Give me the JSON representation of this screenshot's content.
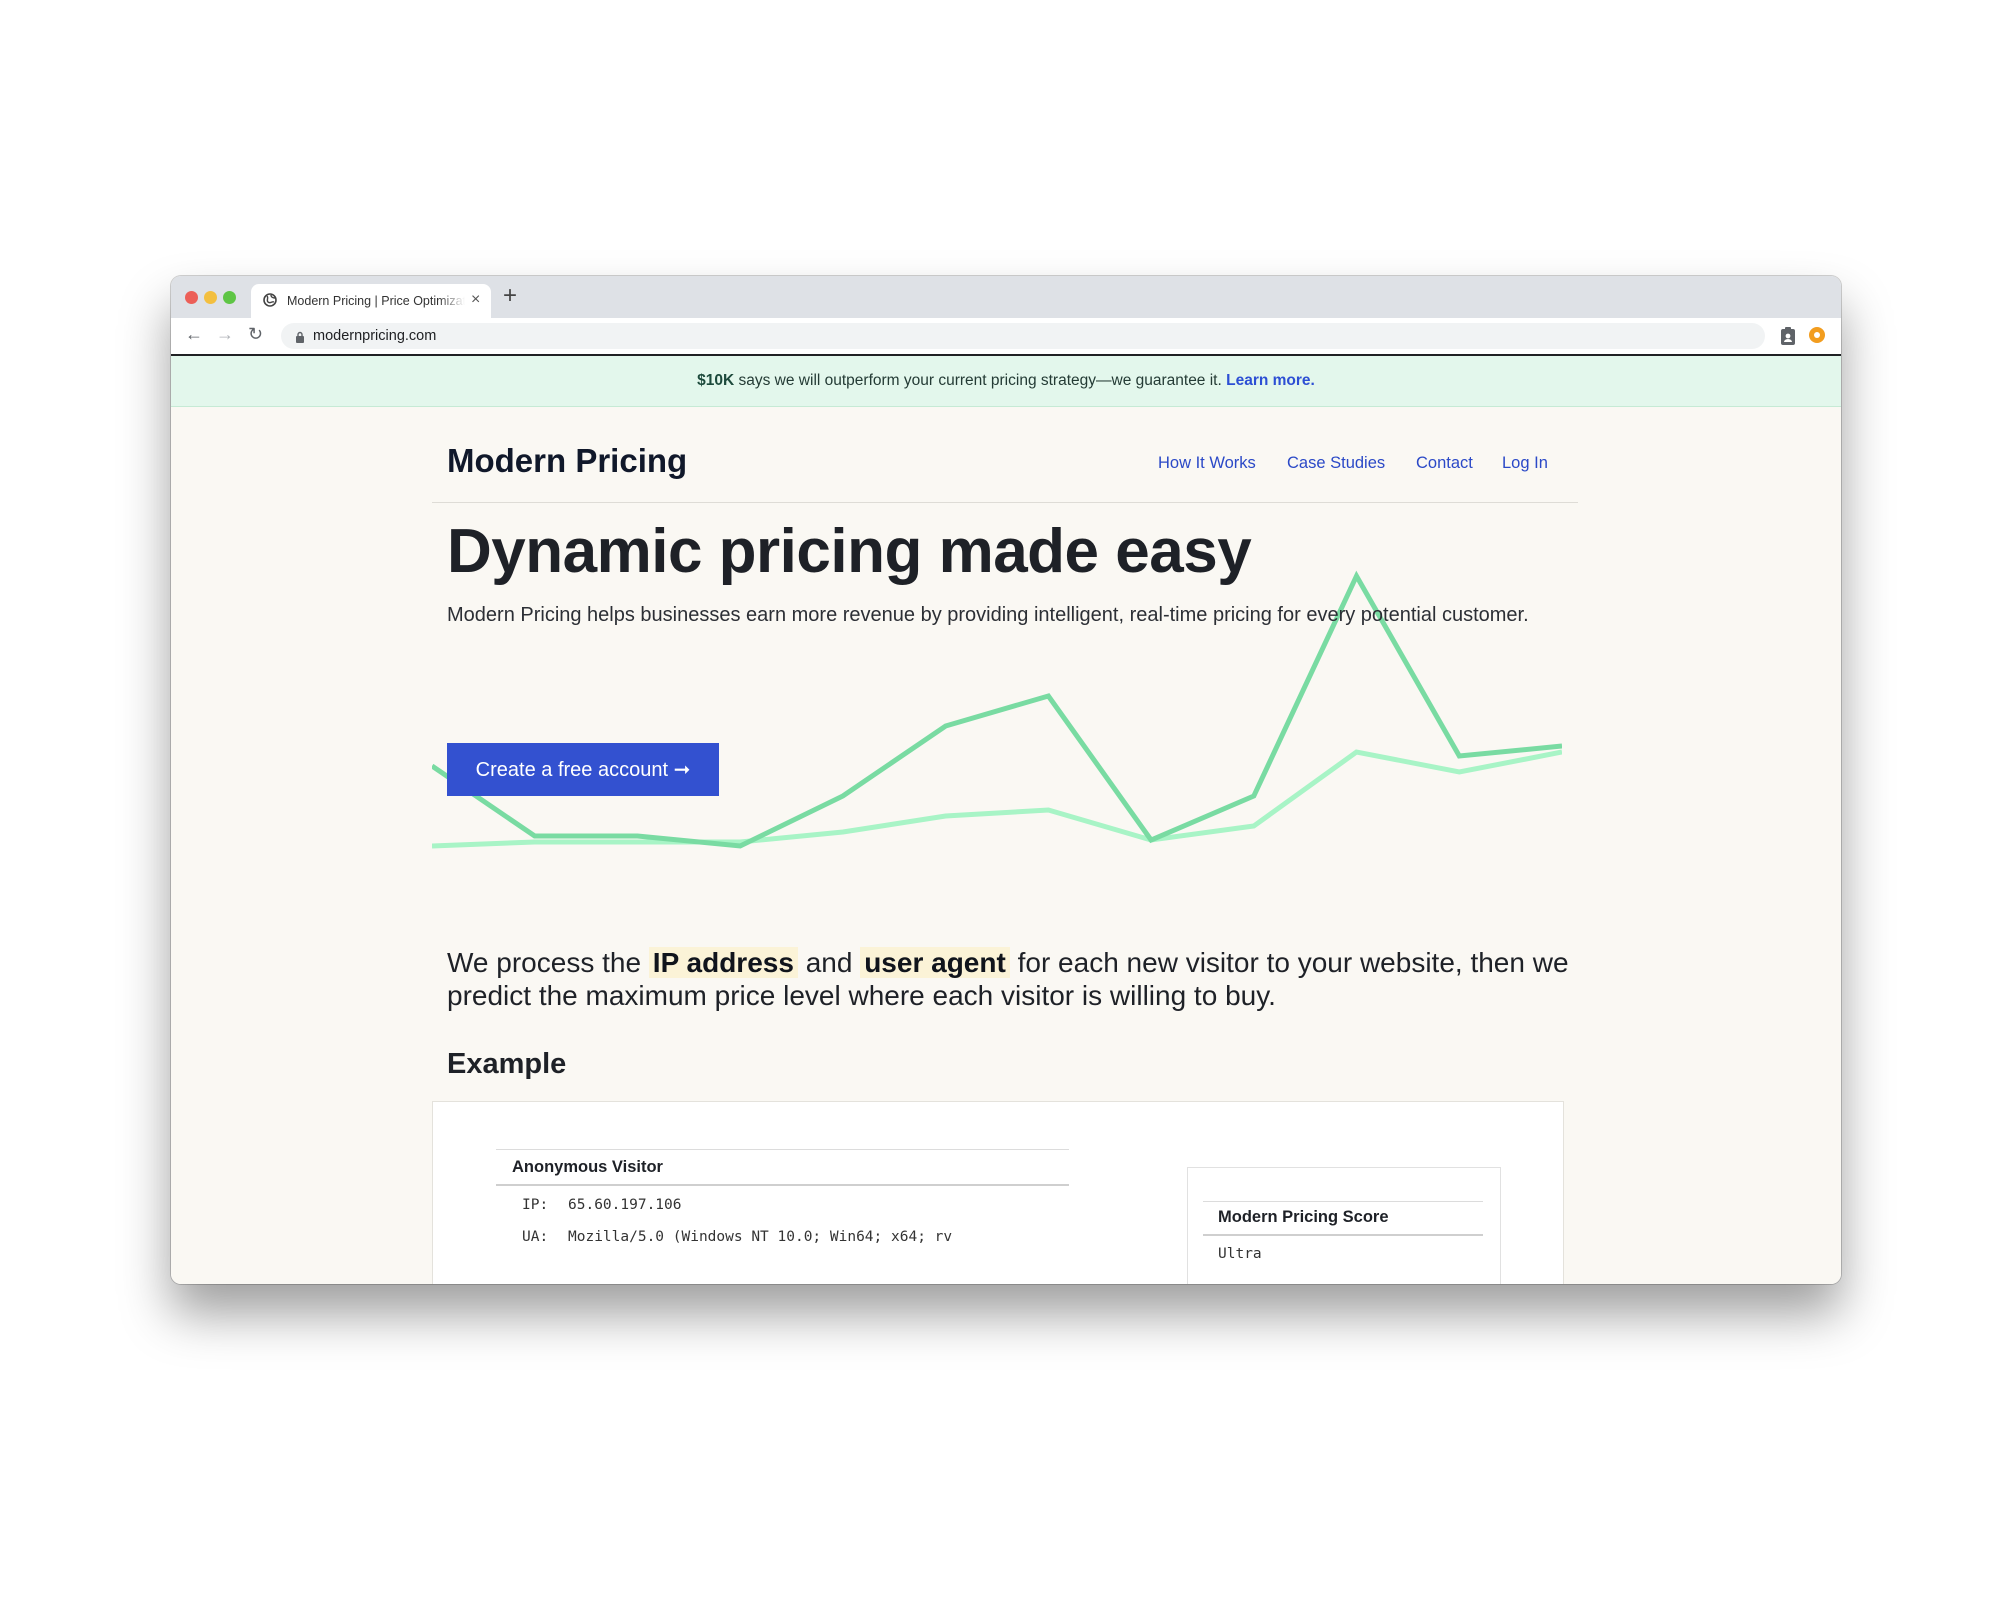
{
  "browser": {
    "tab_title": "Modern Pricing | Price Optimization",
    "tab_close": "×",
    "new_tab": "+",
    "url": "modernpricing.com",
    "back": "←",
    "forward": "→",
    "reload": "↻"
  },
  "banner": {
    "amount": "$10K",
    "text": " says we will outperform your current pricing strategy—we guarantee it. ",
    "link": "Learn more."
  },
  "header": {
    "logo": "Modern Pricing",
    "nav": [
      "How It Works",
      "Case Studies",
      "Contact",
      "Log In"
    ]
  },
  "hero": {
    "title": "Dynamic pricing made easy",
    "subtitle": "Modern Pricing helps businesses earn more revenue by providing intelligent, real-time pricing for every potential customer.",
    "cta": "Create a free account ➞"
  },
  "hero_chart": {
    "colors": [
      "#79dba2",
      "#a8f4c6"
    ],
    "series_a": [
      75,
      40,
      40,
      35,
      60,
      95,
      110,
      38,
      60,
      170,
      80,
      85
    ],
    "series_b": [
      35,
      37,
      37,
      37,
      42,
      50,
      53,
      38,
      45,
      82,
      72,
      82
    ]
  },
  "process": {
    "part1": "We process the ",
    "highlight1": "IP address",
    "part2": " and ",
    "highlight2": "user agent",
    "part3": " for each new visitor to your website, then we predict the maximum price level where each visitor is willing to buy."
  },
  "example": {
    "title": "Example",
    "visitor_title": "Anonymous Visitor",
    "ip_label": "IP:",
    "ip_value": "65.60.197.106",
    "ua_label": "UA:",
    "ua_value": "Mozilla/5.0 (Windows NT 10.0; Win64; x64; rv",
    "score_title": "Modern Pricing Score",
    "score_value": "Ultra"
  }
}
